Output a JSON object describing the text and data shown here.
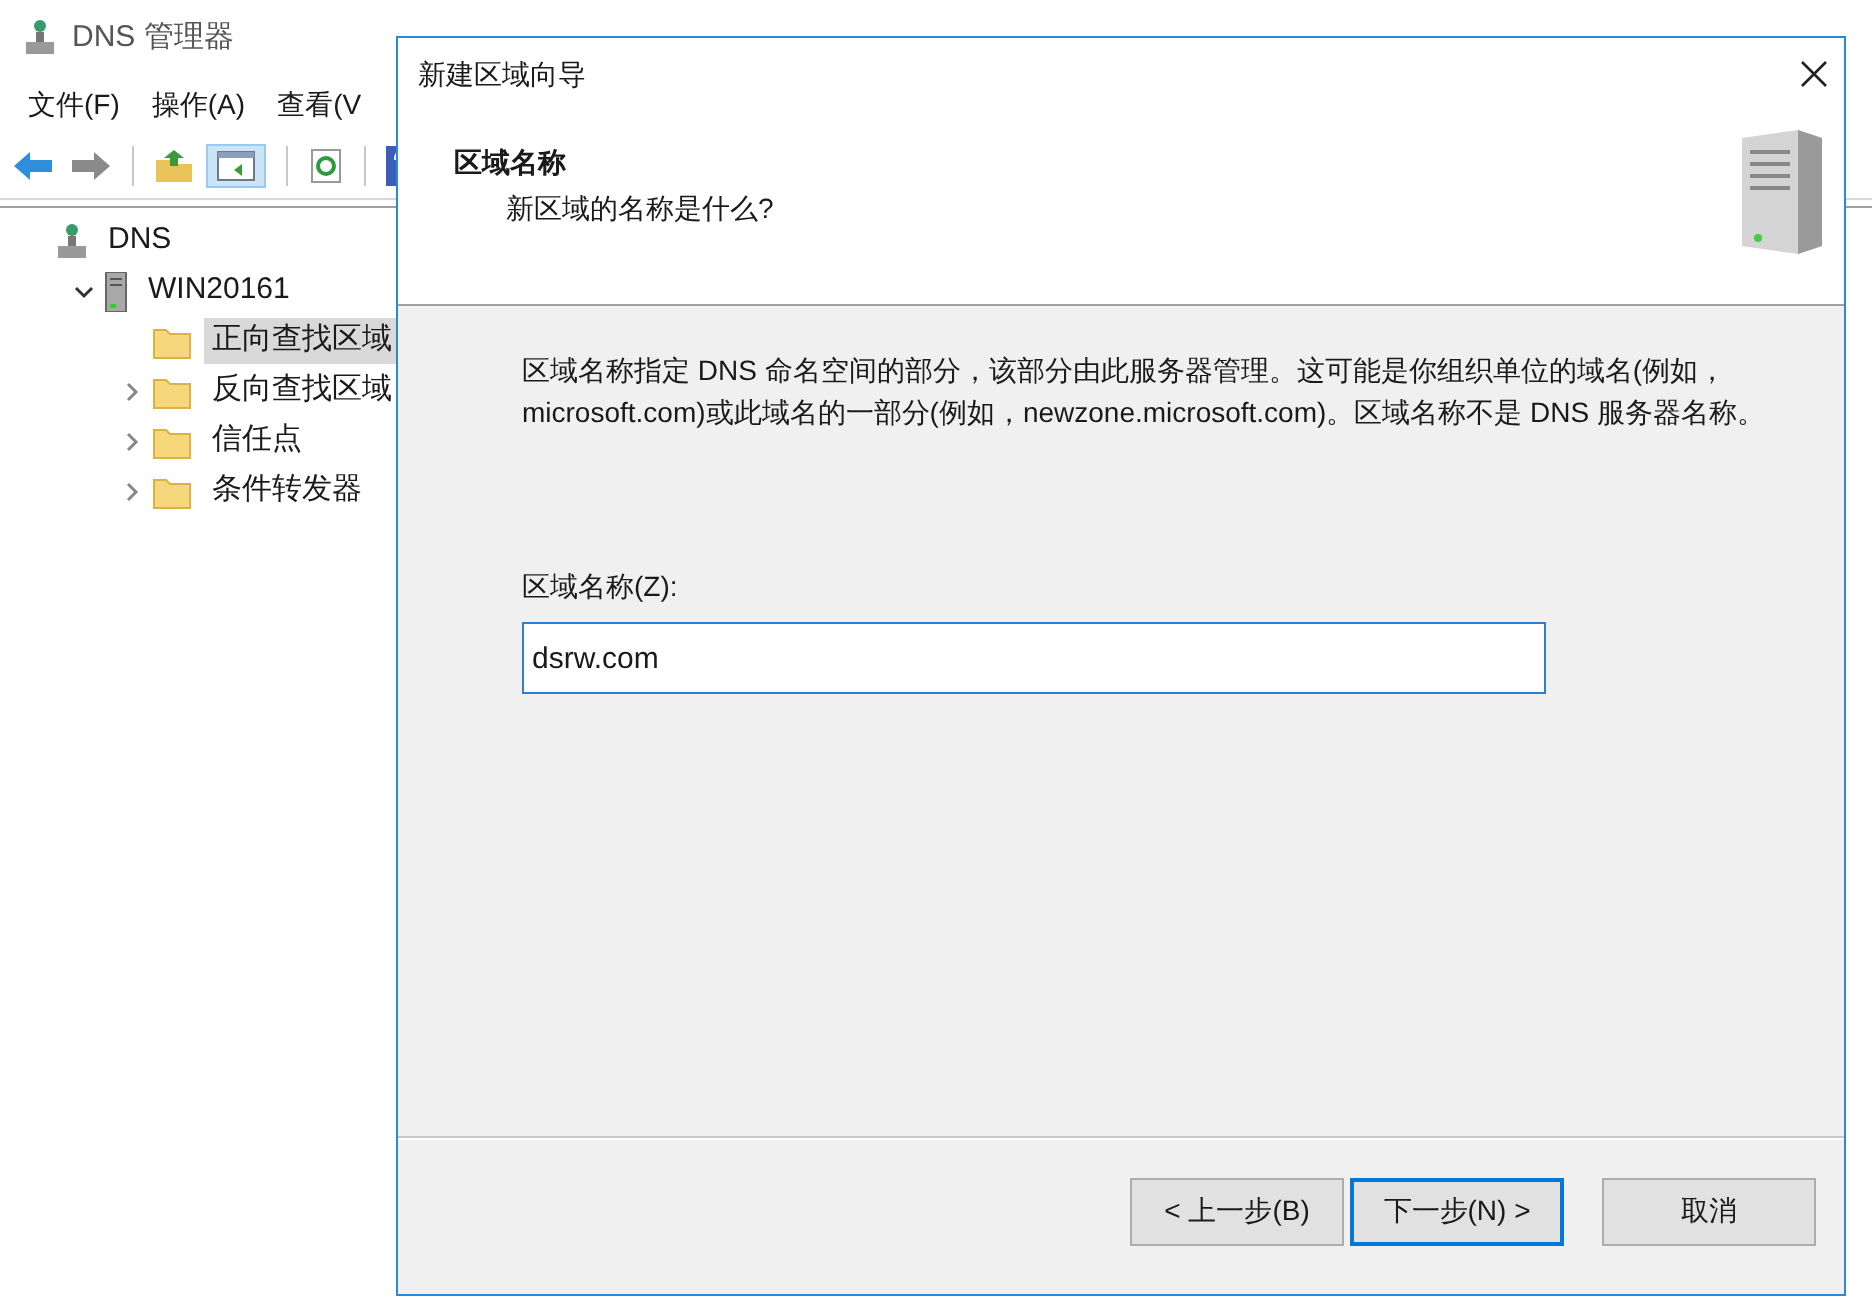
{
  "main_window": {
    "title": "DNS 管理器",
    "menu": [
      "文件(F)",
      "操作(A)",
      "查看(V"
    ],
    "toolbar": [
      {
        "kind": "back"
      },
      {
        "kind": "forward"
      },
      {
        "kind": "sep"
      },
      {
        "kind": "up"
      },
      {
        "kind": "pane",
        "selected": true
      },
      {
        "kind": "sep"
      },
      {
        "kind": "refresh"
      },
      {
        "kind": "sep"
      },
      {
        "kind": "help"
      }
    ],
    "tree": [
      {
        "label": "DNS",
        "kind": "root",
        "children": [
          {
            "label": "WIN20161",
            "kind": "server",
            "expanded": true,
            "children": [
              {
                "label": "正向查找区域",
                "kind": "folder",
                "selected": true,
                "expandable": false
              },
              {
                "label": "反向查找区域",
                "kind": "folder",
                "selected": false,
                "expandable": true
              },
              {
                "label": "信任点",
                "kind": "folder",
                "selected": false,
                "expandable": true
              },
              {
                "label": "条件转发器",
                "kind": "folder",
                "selected": false,
                "expandable": true
              }
            ]
          }
        ]
      }
    ]
  },
  "dialog": {
    "title": "新建区域向导",
    "header": {
      "title": "区域名称",
      "subtitle": "新区域的名称是什么?"
    },
    "description": "区域名称指定 DNS 命名空间的部分，该部分由此服务器管理。这可能是你组织单位的域名(例如，microsoft.com)或此域名的一部分(例如，newzone.microsoft.com)。区域名称不是 DNS 服务器名称。",
    "field": {
      "label": "区域名称(Z):",
      "value": "dsrw.com"
    },
    "buttons": [
      {
        "label": "< 上一步(B)",
        "default": false
      },
      {
        "label": "下一步(N) >",
        "default": true
      },
      {
        "label": "取消",
        "default": false
      }
    ]
  }
}
